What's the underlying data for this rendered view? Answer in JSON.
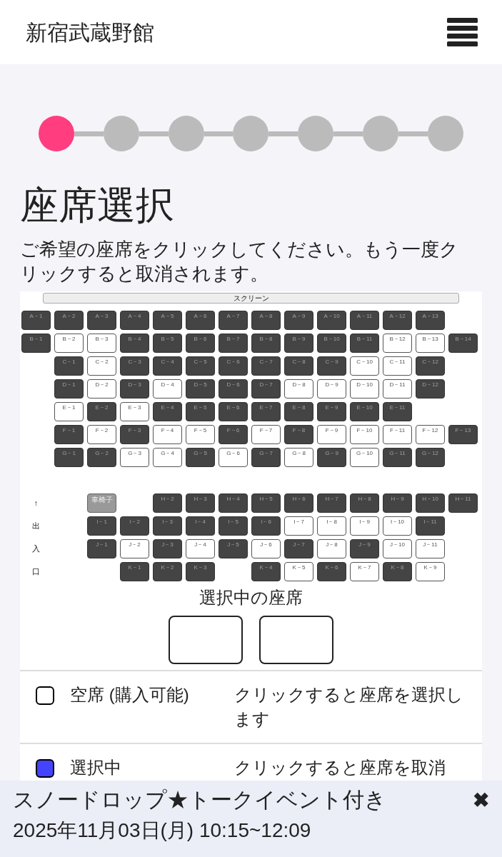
{
  "header": {
    "title": "新宿武蔵野館"
  },
  "steps": [
    {
      "selected": true
    },
    {
      "selected": false
    },
    {
      "selected": false
    },
    {
      "selected": false
    },
    {
      "selected": false
    },
    {
      "selected": false
    },
    {
      "selected": false
    }
  ],
  "heading": "座席選択",
  "instruction": "ご希望の座席をクリックしてください。もう一度クリックすると取消されます。",
  "seat_map": {
    "screen": "スクリーン",
    "exit_sign": [
      "↑",
      "出",
      "入",
      "口"
    ],
    "blocks": [
      {
        "rows": [
          [
            {
              "label": "A－1",
              "kind": "sold"
            },
            {
              "label": "A－2",
              "kind": "sold"
            },
            {
              "label": "A－3",
              "kind": "sold"
            },
            {
              "label": "A－4",
              "kind": "sold"
            },
            {
              "label": "A－5",
              "kind": "sold"
            },
            {
              "label": "A－6",
              "kind": "sold"
            },
            {
              "label": "A－7",
              "kind": "sold"
            },
            {
              "label": "A－8",
              "kind": "sold"
            },
            {
              "label": "A－9",
              "kind": "sold"
            },
            {
              "label": "A－10",
              "kind": "sold"
            },
            {
              "label": "A－11",
              "kind": "sold"
            },
            {
              "label": "A－12",
              "kind": "sold"
            },
            {
              "label": "A－13",
              "kind": "sold"
            },
            null
          ],
          [
            {
              "label": "B－1",
              "kind": "sold"
            },
            {
              "label": "B－2",
              "kind": "open"
            },
            {
              "label": "B－3",
              "kind": "open"
            },
            {
              "label": "B－4",
              "kind": "sold"
            },
            {
              "label": "B－5",
              "kind": "sold"
            },
            {
              "label": "B－6",
              "kind": "sold"
            },
            {
              "label": "B－7",
              "kind": "sold"
            },
            {
              "label": "B－8",
              "kind": "sold"
            },
            {
              "label": "B－9",
              "kind": "sold"
            },
            {
              "label": "B－10",
              "kind": "sold"
            },
            {
              "label": "B－11",
              "kind": "sold"
            },
            {
              "label": "B－12",
              "kind": "open"
            },
            {
              "label": "B－13",
              "kind": "open"
            },
            {
              "label": "B－14",
              "kind": "sold"
            }
          ],
          [
            null,
            {
              "label": "C－1",
              "kind": "sold"
            },
            {
              "label": "C－2",
              "kind": "open"
            },
            {
              "label": "C－3",
              "kind": "sold"
            },
            {
              "label": "C－4",
              "kind": "sold"
            },
            {
              "label": "C－5",
              "kind": "sold"
            },
            {
              "label": "C－6",
              "kind": "sold"
            },
            {
              "label": "C－7",
              "kind": "sold"
            },
            {
              "label": "C－8",
              "kind": "sold"
            },
            {
              "label": "C－9",
              "kind": "sold"
            },
            {
              "label": "C－10",
              "kind": "open"
            },
            {
              "label": "C－11",
              "kind": "open"
            },
            {
              "label": "C－12",
              "kind": "sold"
            },
            null
          ],
          [
            null,
            {
              "label": "D－1",
              "kind": "sold"
            },
            {
              "label": "D－2",
              "kind": "open"
            },
            {
              "label": "D－3",
              "kind": "sold"
            },
            {
              "label": "D－4",
              "kind": "open"
            },
            {
              "label": "D－5",
              "kind": "sold"
            },
            {
              "label": "D－6",
              "kind": "sold"
            },
            {
              "label": "D－7",
              "kind": "sold"
            },
            {
              "label": "D－8",
              "kind": "open"
            },
            {
              "label": "D－9",
              "kind": "open"
            },
            {
              "label": "D－10",
              "kind": "open"
            },
            {
              "label": "D－11",
              "kind": "open"
            },
            {
              "label": "D－12",
              "kind": "sold"
            },
            null
          ],
          [
            null,
            {
              "label": "E－1",
              "kind": "open"
            },
            {
              "label": "E－2",
              "kind": "sold"
            },
            {
              "label": "E－3",
              "kind": "open"
            },
            {
              "label": "E－4",
              "kind": "sold"
            },
            {
              "label": "E－5",
              "kind": "sold"
            },
            {
              "label": "E－6",
              "kind": "sold"
            },
            {
              "label": "E－7",
              "kind": "sold"
            },
            {
              "label": "E－8",
              "kind": "sold"
            },
            {
              "label": "E－9",
              "kind": "sold"
            },
            {
              "label": "E－10",
              "kind": "sold"
            },
            {
              "label": "E－11",
              "kind": "sold"
            },
            null,
            null
          ],
          [
            null,
            {
              "label": "F－1",
              "kind": "sold"
            },
            {
              "label": "F－2",
              "kind": "open"
            },
            {
              "label": "F－3",
              "kind": "sold"
            },
            {
              "label": "F－4",
              "kind": "open"
            },
            {
              "label": "F－5",
              "kind": "open"
            },
            {
              "label": "F－6",
              "kind": "sold"
            },
            {
              "label": "F－7",
              "kind": "open"
            },
            {
              "label": "F－8",
              "kind": "sold"
            },
            {
              "label": "F－9",
              "kind": "open"
            },
            {
              "label": "F－10",
              "kind": "open"
            },
            {
              "label": "F－11",
              "kind": "open"
            },
            {
              "label": "F－12",
              "kind": "open"
            },
            {
              "label": "F－13",
              "kind": "sold"
            }
          ],
          [
            null,
            {
              "label": "G－1",
              "kind": "sold"
            },
            {
              "label": "G－2",
              "kind": "sold"
            },
            {
              "label": "G－3",
              "kind": "open"
            },
            {
              "label": "G－4",
              "kind": "open"
            },
            {
              "label": "G－5",
              "kind": "sold"
            },
            {
              "label": "G－6",
              "kind": "open"
            },
            {
              "label": "G－7",
              "kind": "sold"
            },
            {
              "label": "G－8",
              "kind": "open"
            },
            {
              "label": "G－9",
              "kind": "sold"
            },
            {
              "label": "G－10",
              "kind": "open"
            },
            {
              "label": "G－11",
              "kind": "sold"
            },
            {
              "label": "G－12",
              "kind": "sold"
            },
            null
          ]
        ]
      },
      {
        "rows": [
          [
            null,
            null,
            {
              "label": "車椅子",
              "kind": "wheelchair"
            },
            null,
            {
              "label": "H－2",
              "kind": "sold"
            },
            {
              "label": "H－3",
              "kind": "sold"
            },
            {
              "label": "H－4",
              "kind": "sold"
            },
            {
              "label": "H－5",
              "kind": "sold"
            },
            {
              "label": "H－6",
              "kind": "sold"
            },
            {
              "label": "H－7",
              "kind": "sold"
            },
            {
              "label": "H－8",
              "kind": "sold"
            },
            {
              "label": "H－9",
              "kind": "sold"
            },
            {
              "label": "H－10",
              "kind": "sold"
            },
            {
              "label": "H－11",
              "kind": "sold"
            }
          ],
          [
            null,
            null,
            {
              "label": "I－1",
              "kind": "sold"
            },
            {
              "label": "I－2",
              "kind": "sold"
            },
            {
              "label": "I－3",
              "kind": "sold"
            },
            {
              "label": "I－4",
              "kind": "sold"
            },
            {
              "label": "I－5",
              "kind": "sold"
            },
            {
              "label": "I－6",
              "kind": "sold"
            },
            {
              "label": "I－7",
              "kind": "open"
            },
            {
              "label": "I－8",
              "kind": "open"
            },
            {
              "label": "I－9",
              "kind": "open"
            },
            {
              "label": "I－10",
              "kind": "open"
            },
            {
              "label": "I－11",
              "kind": "sold"
            },
            null
          ],
          [
            null,
            null,
            {
              "label": "J－1",
              "kind": "sold"
            },
            {
              "label": "J－2",
              "kind": "open"
            },
            {
              "label": "J－3",
              "kind": "sold"
            },
            {
              "label": "J－4",
              "kind": "open"
            },
            {
              "label": "J－5",
              "kind": "sold"
            },
            {
              "label": "J－6",
              "kind": "open"
            },
            {
              "label": "J－7",
              "kind": "sold"
            },
            {
              "label": "J－8",
              "kind": "open"
            },
            {
              "label": "J－9",
              "kind": "sold"
            },
            {
              "label": "J－10",
              "kind": "open"
            },
            {
              "label": "J－11",
              "kind": "open"
            },
            null
          ],
          [
            null,
            null,
            null,
            {
              "label": "K－1",
              "kind": "sold"
            },
            {
              "label": "K－2",
              "kind": "sold"
            },
            {
              "label": "K－3",
              "kind": "sold"
            },
            null,
            {
              "label": "K－4",
              "kind": "sold"
            },
            {
              "label": "K－5",
              "kind": "open"
            },
            {
              "label": "K－6",
              "kind": "sold"
            },
            {
              "label": "K－7",
              "kind": "open"
            },
            {
              "label": "K－8",
              "kind": "sold"
            },
            {
              "label": "K－9",
              "kind": "open"
            },
            null
          ]
        ]
      }
    ]
  },
  "selected_seats": {
    "title": "選択中の座席",
    "slots": [
      {
        "kind": "empty"
      },
      {
        "kind": "empty"
      }
    ]
  },
  "legend": [
    {
      "kind": "open",
      "name": "空席 (購入可能)",
      "note": "クリックすると座席を選択します"
    },
    {
      "kind": "selected",
      "name": "選択中",
      "note": "クリックすると座席を取消"
    }
  ],
  "event_bar": {
    "title": "スノードロップ★トークイベント付き",
    "datetime": "2025年11月03日(月) 10:15~12:09",
    "close": "✖"
  }
}
